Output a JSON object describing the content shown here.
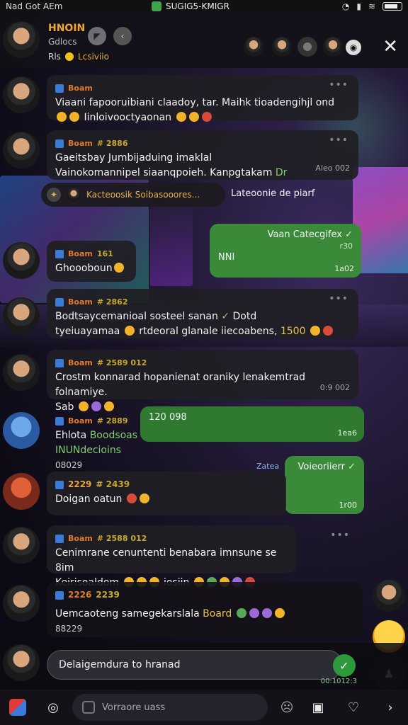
{
  "status_bar": {
    "left_text": "Nad Got AEm",
    "center_text": "SUGIG5-KMIGR"
  },
  "header": {
    "title": "HNOIN",
    "subtitle": "Gdlocs",
    "status_text": "Rls",
    "status_green": "Lcsiviio"
  },
  "messages": [
    {
      "name": "Boam",
      "tag": "",
      "text": "Viaani fapooruibiani claadoy, tar. Maihk tioadengihjl ond",
      "text_tail": "Iinloivooctyaonan",
      "time": ""
    },
    {
      "name": "Boam",
      "tag": "# 2886",
      "text": "Gaeitsbay Jumbijaduing imaklal",
      "text2": "Vainokomannipel siaanqpoieh. Kanpgtakam",
      "text2_hl": "Dr",
      "time": "Aleo 002"
    },
    {
      "name": "Boam",
      "tag": "161",
      "text": "Ghoooboun",
      "time": ""
    },
    {
      "name": "Boam",
      "tag": "# 2862",
      "text": "Bodtsaycemanioal sosteel sanan",
      "text_hl": "Dotd",
      "text2": "tyeiuayamaa",
      "text2b": "rtdeoral glanale iiecoabens,",
      "text2_num": "1500",
      "time": ""
    },
    {
      "name": "Boam",
      "tag": "# 2589 012",
      "text": "Crostm konnarad hopanienat oraniky lenakemtrad folnamiye.",
      "text2": "Sab",
      "time": "0:9 002"
    },
    {
      "name": "Boam",
      "tag": "# 2889",
      "text": "Ehlota",
      "text_hl": "Boodsoas INUNdecioins",
      "sub": "08029",
      "time": ""
    },
    {
      "name": "2229",
      "tag": "# 2439",
      "text": "Doigan oatun",
      "time": ""
    },
    {
      "name": "Boam",
      "tag": "# 2588 012",
      "text": "Cenimrane cenuntenti benabara imnsune se 8im",
      "text2": "Keirisoaldom",
      "text2b": "iosiin",
      "time": ""
    },
    {
      "name": "2226",
      "tag": "2239",
      "text": "Uemcaoteng samegekarslala",
      "text_hl": "Board",
      "sub": "88229",
      "time": ""
    }
  ],
  "pinned": {
    "text": "Kacteoosik Soibasooores...",
    "note": "Lateoonie de piarf"
  },
  "green_bubbles": [
    {
      "header": "Vaan Catecgifex",
      "line": "NNI",
      "time": "1a02",
      "extra": "r30"
    },
    {
      "header": "120 098",
      "line": "",
      "time": "1ea6"
    },
    {
      "header": "Voieoriierr",
      "line": "",
      "time": "1r00",
      "label": "Zatea"
    }
  ],
  "input": {
    "value": "Delaigemdura to hranad",
    "time": "00:1012:3"
  },
  "bottom_bar": {
    "search_placeholder": "Vorraore uass"
  },
  "colors": {
    "accent_orange": "#e07a2a",
    "green_bubble": "#3a8a3a",
    "send_green": "#2c9a3a",
    "bubble_dark": "#201e24"
  }
}
